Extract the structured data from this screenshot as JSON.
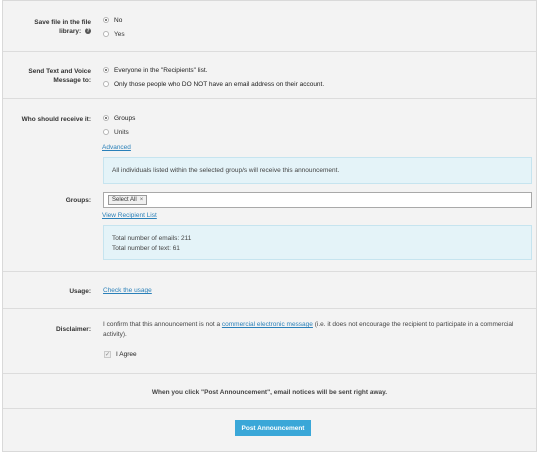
{
  "save_file": {
    "label_line1": "Save file in the file",
    "label_line2": "library:",
    "help_icon": "question-icon",
    "options": [
      "No",
      "Yes"
    ],
    "selected": "No"
  },
  "send_text": {
    "label_line1": "Send Text and Voice",
    "label_line2": "Message to:",
    "options": [
      "Everyone in the \"Recipients\" list.",
      "Only those people who DO NOT have an email address on their account."
    ],
    "selected": "Everyone in the \"Recipients\" list."
  },
  "recipients": {
    "label": "Who should receive it:",
    "options": [
      "Groups",
      "Units"
    ],
    "selected": "Groups",
    "advanced_link": "Advanced",
    "info_text": "All individuals listed within the selected group/s will receive this announcement."
  },
  "groups": {
    "label": "Groups:",
    "selected_tag": "Select All",
    "tag_remove": "×",
    "view_link": "View Recipient List",
    "emails_line": "Total number of emails: 211",
    "texts_line": "Total number of text: 61"
  },
  "usage": {
    "label": "Usage:",
    "link": "Check the usage"
  },
  "disclaimer": {
    "label": "Disclaimer:",
    "text_before": "I confirm that this announcement is not a ",
    "text_link": "commercial electronic message",
    "text_after": " (i.e. it does not encourage the recipient to participate in a commercial activity).",
    "agree_label": "I Agree",
    "check_glyph": "✓"
  },
  "footer": {
    "notice": "When you click \"Post Announcement\", email notices will be sent right away.",
    "post_button": "Post Announcement"
  },
  "colors": {
    "accent": "#3aa7d8",
    "link": "#2a80b9",
    "info_bg": "#e4f3f8"
  }
}
